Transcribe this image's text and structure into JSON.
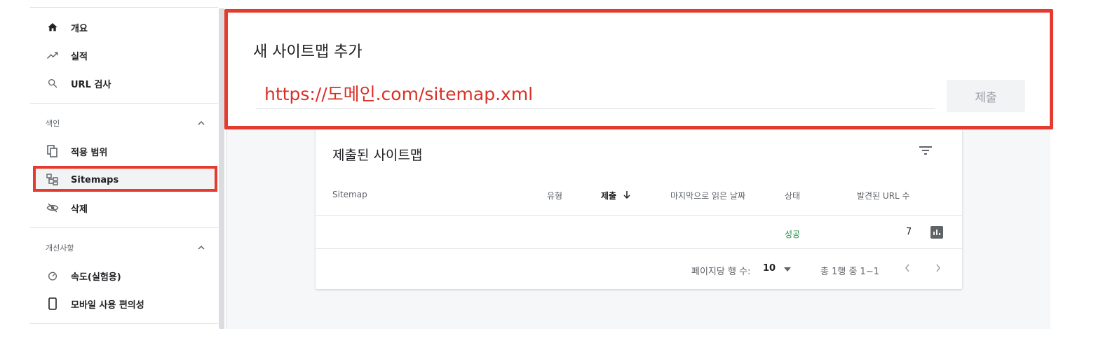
{
  "sidebar": {
    "items_top": [
      {
        "label": "개요",
        "icon": "home-icon"
      },
      {
        "label": "실적",
        "icon": "trending-up-icon"
      },
      {
        "label": "URL 검사",
        "icon": "search-icon"
      }
    ],
    "section_index": {
      "label": "색인"
    },
    "items_index": [
      {
        "label": "적용 범위",
        "icon": "copy-icon"
      },
      {
        "label": "Sitemaps",
        "icon": "sitemap-icon"
      },
      {
        "label": "삭제",
        "icon": "eye-off-icon"
      }
    ],
    "section_enhance": {
      "label": "개선사항"
    },
    "items_enhance": [
      {
        "label": "속도(실험용)",
        "icon": "speed-gauge-icon"
      },
      {
        "label": "모바일 사용 편의성",
        "icon": "mobile-icon"
      }
    ]
  },
  "add_sitemap": {
    "title": "새 사이트맵 추가",
    "url_value": "https://도메인.com/sitemap.xml",
    "submit_label": "제출"
  },
  "submitted": {
    "title": "제출된 사이트맵",
    "columns": {
      "sitemap": "Sitemap",
      "type": "유형",
      "submitted": "제출",
      "last_read": "마지막으로 읽은 날짜",
      "status": "상태",
      "discovered": "발견된 URL 수"
    },
    "row": {
      "status": "성공",
      "discovered": "7"
    },
    "pagination": {
      "rows_per_page_label": "페이지당 행 수:",
      "rows_per_page_value": "10",
      "range": "총 1행 중 1~1"
    }
  },
  "colors": {
    "highlight": "#e53a2e",
    "success": "#1e8e3e",
    "url_text": "#d93025"
  }
}
